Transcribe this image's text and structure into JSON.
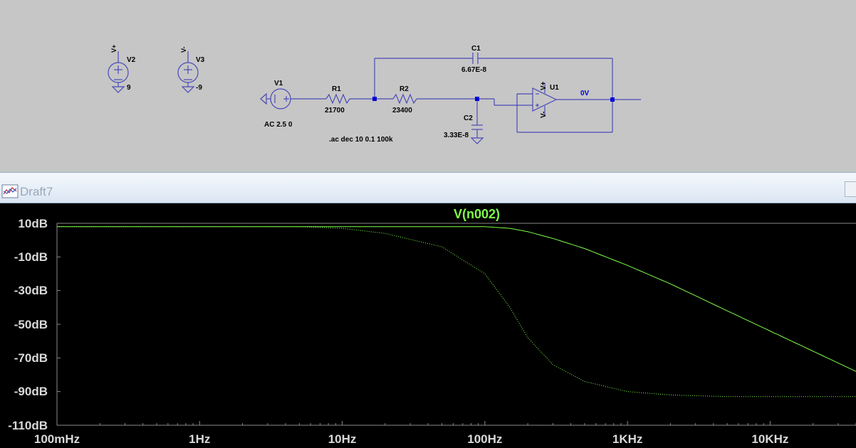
{
  "schematic": {
    "components": {
      "v2": {
        "name": "V2",
        "value": "9"
      },
      "v3": {
        "name": "V3",
        "value": "-9"
      },
      "v1": {
        "name": "V1",
        "value": "AC 2.5 0"
      },
      "r1": {
        "name": "R1",
        "value": "21700"
      },
      "r2": {
        "name": "R2",
        "value": "23400"
      },
      "c1": {
        "name": "C1",
        "value": "6.67E-8"
      },
      "c2": {
        "name": "C2",
        "value": "3.33E-8"
      },
      "u1": {
        "name": "U1"
      }
    },
    "pins": {
      "vplus": "V+",
      "vminus": "V-"
    },
    "directive": ".ac dec 10 0.1 100k",
    "node_label": "0V",
    "colors": {
      "wire": "#4a4ab8",
      "background": "#c6c6c6",
      "node_label": "#0000d8"
    }
  },
  "plot_window": {
    "title": "Draft7",
    "icon": "waveform-window-icon"
  },
  "plot": {
    "trace_name": "V(n002)",
    "trace_color": "#7fff4a",
    "background": "#000000"
  },
  "chart_data": {
    "type": "line",
    "title": "V(n002)",
    "x_scale": "log",
    "xlim": [
      0.1,
      40000
    ],
    "ylim": [
      -110,
      10
    ],
    "y_ticks": [
      "10dB",
      "-10dB",
      "-30dB",
      "-50dB",
      "-70dB",
      "-90dB",
      "-110dB"
    ],
    "x_ticks": [
      "100mHz",
      "1Hz",
      "10Hz",
      "100Hz",
      "1KHz",
      "10KHz"
    ],
    "series": [
      {
        "name": "V(n002)",
        "style": "solid",
        "x": [
          0.1,
          1,
          10,
          50,
          100,
          150,
          200,
          300,
          500,
          1000,
          2000,
          5000,
          10000,
          20000,
          40000
        ],
        "y": [
          8,
          8,
          8,
          8,
          8,
          7,
          5,
          1,
          -5,
          -15,
          -26,
          -42,
          -54,
          -66,
          -78
        ]
      },
      {
        "name": "V(n002) phase",
        "style": "dotted",
        "x": [
          0.1,
          1,
          5,
          10,
          20,
          50,
          100,
          150,
          200,
          300,
          500,
          1000,
          2000,
          5000,
          10000,
          40000
        ],
        "y": [
          8,
          8,
          8,
          7,
          4,
          -4,
          -20,
          -40,
          -58,
          -74,
          -84,
          -90,
          -92,
          -93,
          -93,
          -93
        ]
      }
    ]
  }
}
